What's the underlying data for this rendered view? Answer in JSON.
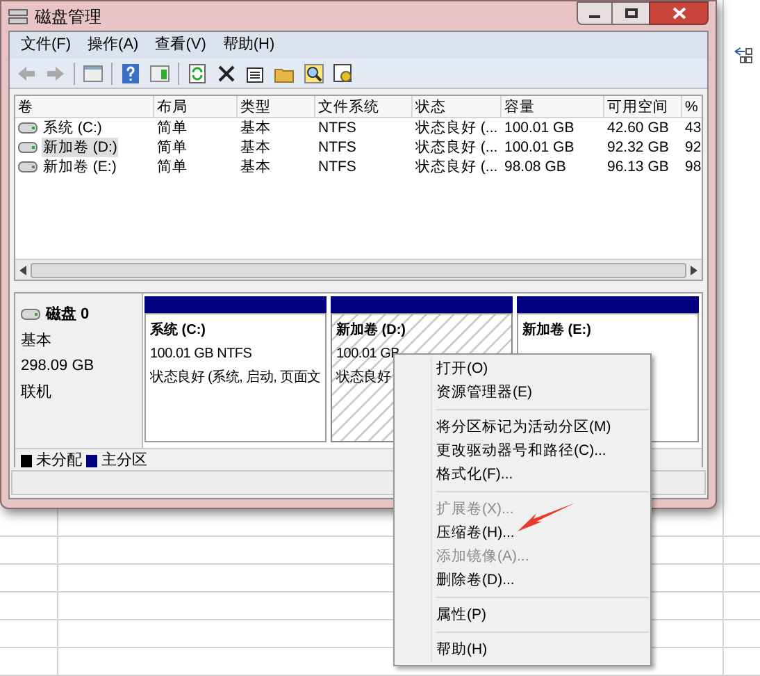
{
  "window": {
    "title": "磁盘管理"
  },
  "menu_bar": [
    "文件(F)",
    "操作(A)",
    "查看(V)",
    "帮助(H)"
  ],
  "table": {
    "columns": [
      "卷",
      "布局",
      "类型",
      "文件系统",
      "状态",
      "容量",
      "可用空间",
      "%"
    ],
    "rows": [
      {
        "selected": false,
        "cells": [
          "系统 (C:)",
          "简单",
          "基本",
          "NTFS",
          "状态良好 (...",
          "100.01 GB",
          "42.60 GB",
          "43"
        ]
      },
      {
        "selected": true,
        "cells": [
          "新加卷 (D:)",
          "简单",
          "基本",
          "NTFS",
          "状态良好 (...",
          "100.01 GB",
          "92.32 GB",
          "92"
        ]
      },
      {
        "selected": false,
        "cells": [
          "新加卷 (E:)",
          "简单",
          "基本",
          "NTFS",
          "状态良好 (...",
          "98.08 GB",
          "96.13 GB",
          "98"
        ]
      }
    ]
  },
  "disk": {
    "name": "磁盘 0",
    "type": "基本",
    "size": "298.09 GB",
    "status": "联机",
    "partitions": [
      {
        "name": "系统 (C:)",
        "lines": [
          "100.01 GB NTFS",
          "状态良好 (系统, 启动, 页面文"
        ],
        "selected": false
      },
      {
        "name": "新加卷 (D:)",
        "lines": [
          "100.01 GB",
          "状态良好"
        ],
        "selected": true
      },
      {
        "name": "新加卷 (E:)",
        "selected": false
      }
    ]
  },
  "legend": [
    {
      "label": "未分配",
      "color": "#000000"
    },
    {
      "label": "主分区",
      "color": "#000080"
    }
  ],
  "context_menu": [
    [
      {
        "label": "打开(O)",
        "disabled": false
      },
      {
        "label": "资源管理器(E)",
        "disabled": false
      }
    ],
    [
      {
        "label": "将分区标记为活动分区(M)",
        "disabled": false
      },
      {
        "label": "更改驱动器号和路径(C)...",
        "disabled": false
      },
      {
        "label": "格式化(F)...",
        "disabled": false
      }
    ],
    [
      {
        "label": "扩展卷(X)...",
        "disabled": true
      },
      {
        "label": "压缩卷(H)...",
        "disabled": false
      },
      {
        "label": "添加镜像(A)...",
        "disabled": true
      },
      {
        "label": "删除卷(D)...",
        "disabled": false
      }
    ],
    [
      {
        "label": "属性(P)",
        "disabled": false
      }
    ],
    [
      {
        "label": "帮助(H)",
        "disabled": false
      }
    ]
  ]
}
